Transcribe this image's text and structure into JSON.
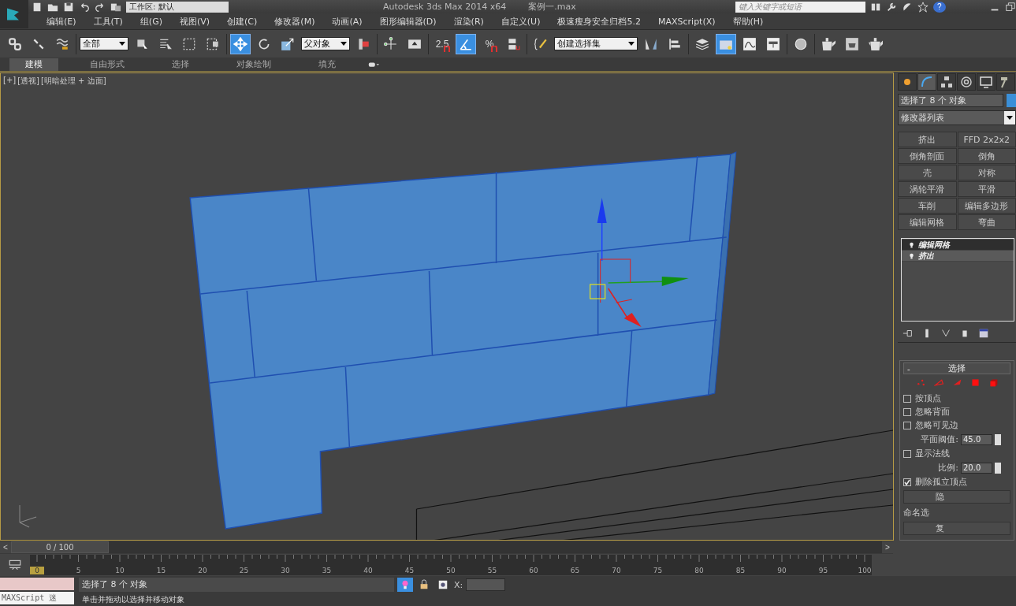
{
  "title_bar": {
    "workspace": "工作区: 默认",
    "title": "Autodesk 3ds Max  2014 x64",
    "file": "案例一.max",
    "search": {
      "placeholder": "键入关键字或短语"
    },
    "help": "?"
  },
  "menu": [
    "编辑(E)",
    "工具(T)",
    "组(G)",
    "视图(V)",
    "创建(C)",
    "修改器(M)",
    "动画(A)",
    "图形编辑器(D)",
    "渲染(R)",
    "自定义(U)",
    "极速瘦身安全归档5.2",
    "MAXScript(X)",
    "帮助(H)"
  ],
  "toolbar": [
    {
      "kind": "icon",
      "selected": false
    },
    {
      "kind": "icon",
      "selected": false
    },
    {
      "kind": "icon",
      "selected": false
    },
    {
      "kind": "sep"
    },
    {
      "kind": "dropdown",
      "value": "全部"
    },
    {
      "kind": "icon",
      "selected": false
    },
    {
      "kind": "icon",
      "selected": false
    },
    {
      "kind": "icon",
      "selected": false
    },
    {
      "kind": "icon",
      "selected": false
    },
    {
      "kind": "sep"
    },
    {
      "kind": "icon",
      "selected": true
    },
    {
      "kind": "icon",
      "selected": false
    },
    {
      "kind": "icon",
      "selected": false
    },
    {
      "kind": "dropdown",
      "value": "父对象"
    },
    {
      "kind": "icon",
      "selected": false
    },
    {
      "kind": "sep"
    },
    {
      "kind": "icon",
      "selected": false
    },
    {
      "kind": "icon",
      "selected": false
    },
    {
      "kind": "sep"
    },
    {
      "kind": "snap",
      "label": "2.5",
      "selected": false
    },
    {
      "kind": "icon",
      "selected": true
    },
    {
      "kind": "snap",
      "label": "%",
      "selected": false
    },
    {
      "kind": "icon",
      "selected": false
    },
    {
      "kind": "sep"
    },
    {
      "kind": "icon",
      "selected": false
    },
    {
      "kind": "dropdown",
      "value": "创建选择集"
    },
    {
      "kind": "icon",
      "selected": false
    },
    {
      "kind": "icon",
      "selected": false
    },
    {
      "kind": "sep"
    },
    {
      "kind": "icon",
      "selected": false
    },
    {
      "kind": "icon",
      "selected": true
    },
    {
      "kind": "icon",
      "selected": false
    },
    {
      "kind": "icon",
      "selected": false
    },
    {
      "kind": "sep"
    },
    {
      "kind": "icon",
      "selected": false
    },
    {
      "kind": "sep"
    },
    {
      "kind": "icon",
      "selected": false
    },
    {
      "kind": "icon",
      "selected": false
    },
    {
      "kind": "icon",
      "selected": false
    }
  ],
  "ribbon_tabs": [
    {
      "label": "建模",
      "selected": true
    },
    {
      "label": "自由形式",
      "selected": false
    },
    {
      "label": "选择",
      "selected": false
    },
    {
      "label": "对象绘制",
      "selected": false
    },
    {
      "label": "填充",
      "selected": false
    }
  ],
  "viewport": {
    "labels": [
      "[+]",
      "[透视]",
      "[明暗处理 + 边面]"
    ]
  },
  "command_panel": {
    "tabs": [
      {
        "selected": false
      },
      {
        "selected": true
      },
      {
        "selected": false
      },
      {
        "selected": false
      },
      {
        "selected": false
      },
      {
        "selected": false
      }
    ],
    "object_name": "选择了 8 个 对象",
    "modifier_list": "修改器列表",
    "modifier_buttons": [
      "挤出",
      "FFD 2x2x2",
      "倒角剖面",
      "倒角",
      "壳",
      "对称",
      "涡轮平滑",
      "平滑",
      "车削",
      "编辑多边形",
      "编辑网格",
      "弯曲"
    ],
    "stack": [
      {
        "label": "编辑网格",
        "selected": true
      },
      {
        "label": "挤出",
        "selected": false
      }
    ],
    "rollout": {
      "collapse": "-",
      "title": "选择",
      "options": [
        {
          "kind": "checkbox",
          "label": "按顶点",
          "checked": false
        },
        {
          "kind": "checkbox",
          "label": "忽略背面",
          "checked": false
        },
        {
          "kind": "checkbox",
          "label": "忽略可见边",
          "checked": false
        },
        {
          "kind": "spinner",
          "label": "平面阈值:",
          "value": "45.0"
        },
        {
          "kind": "checkbox",
          "label": "显示法线",
          "checked": false
        },
        {
          "kind": "spinner",
          "label": "比例:",
          "value": "20.0"
        },
        {
          "kind": "checkbox",
          "label": "删除孤立顶点",
          "checked": true
        }
      ],
      "hide_button": "隐",
      "named_label": "命名选",
      "copy_button": "复"
    }
  },
  "time_slider": {
    "prev": "<",
    "position": "0 / 100",
    "next": ">",
    "level": 0
  },
  "track": {
    "ticks": [
      "0",
      "5",
      "10",
      "15",
      "20",
      "25",
      "30",
      "35",
      "40",
      "45",
      "50",
      "55",
      "60",
      "65",
      "70",
      "75",
      "80",
      "85",
      "90",
      "95",
      "100"
    ]
  },
  "status": {
    "listener": "MAXScript 迷",
    "prompt": "选择了 8 个 对象",
    "x_label": "X:",
    "hint": "单击并拖动以选择并移动对象"
  }
}
